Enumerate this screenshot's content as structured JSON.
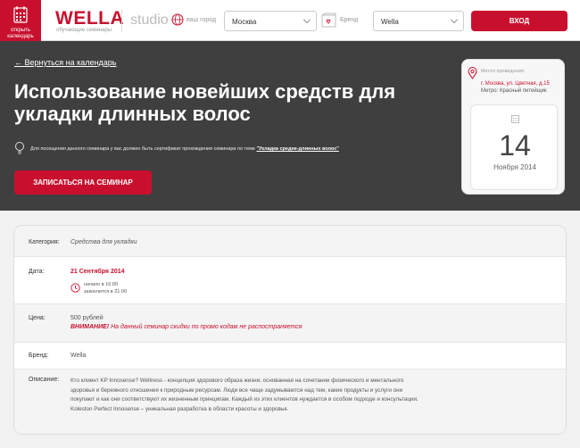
{
  "header": {
    "calendar_button": "открыть календарь",
    "logo": "WELLA",
    "logo_subtitle": "обучающие семинары",
    "studio": "studio",
    "city_label": "ваш город",
    "city_value": "Москва",
    "brand_label": "Бренд",
    "brand_value": "Wella",
    "login_button": "ВХОД"
  },
  "hero": {
    "back_link": "← Вернуться на календарь",
    "title": "Использование новейших средств для укладки длинных волос",
    "hint_prefix": "Для посещения данного семинара у вас должен быть сертификат прохождения семинара по теме ",
    "hint_link": "\"Укладка средне-длинных волос\"",
    "signup_button": "ЗАПИСАТЬСЯ НА СЕМИНАР"
  },
  "place": {
    "label": "Место проведения:",
    "address": "г. Москва, ул. Цветная, д.15",
    "metro": "Метро: Красный питейщик",
    "day": "14",
    "month_year": "Ноября 2014"
  },
  "details": {
    "category_label": "Категория:",
    "category_value": "Средства для укладки",
    "date_label": "Дата:",
    "date_value": "21 Сентября 2014",
    "start_time": "начало в 16:00",
    "end_time": "закончится в 21:00",
    "price_label": "Цена:",
    "price_value": "500 рублей",
    "price_warning_bold": "ВНИМАНИЕ!",
    "price_warning": " На данный семинар скидки по промо кодам не распостраняется",
    "brand_label": "Бренд:",
    "brand_value": "Wella",
    "description_label": "Описание:",
    "description": "Кто клиент KP Innosense? Wellness - концепция здорового образа жизни, основанная на сочетании физического и ментального здоровья и бережного отношения к природным ресурсам. Люди все чаще задумываются над тем, какие продукты и услуги они покупают и как они соответствуют их жизненным принципам. Каждый из этих клиентов нуждается в особом подходе и консультации. Koleston Perfect Innosense – уникальная разработка в области красоты и здоровья."
  },
  "colors": {
    "accent": "#c8102e",
    "hero_bg": "#3f3f3f",
    "page_bg": "#f2f2f2"
  }
}
